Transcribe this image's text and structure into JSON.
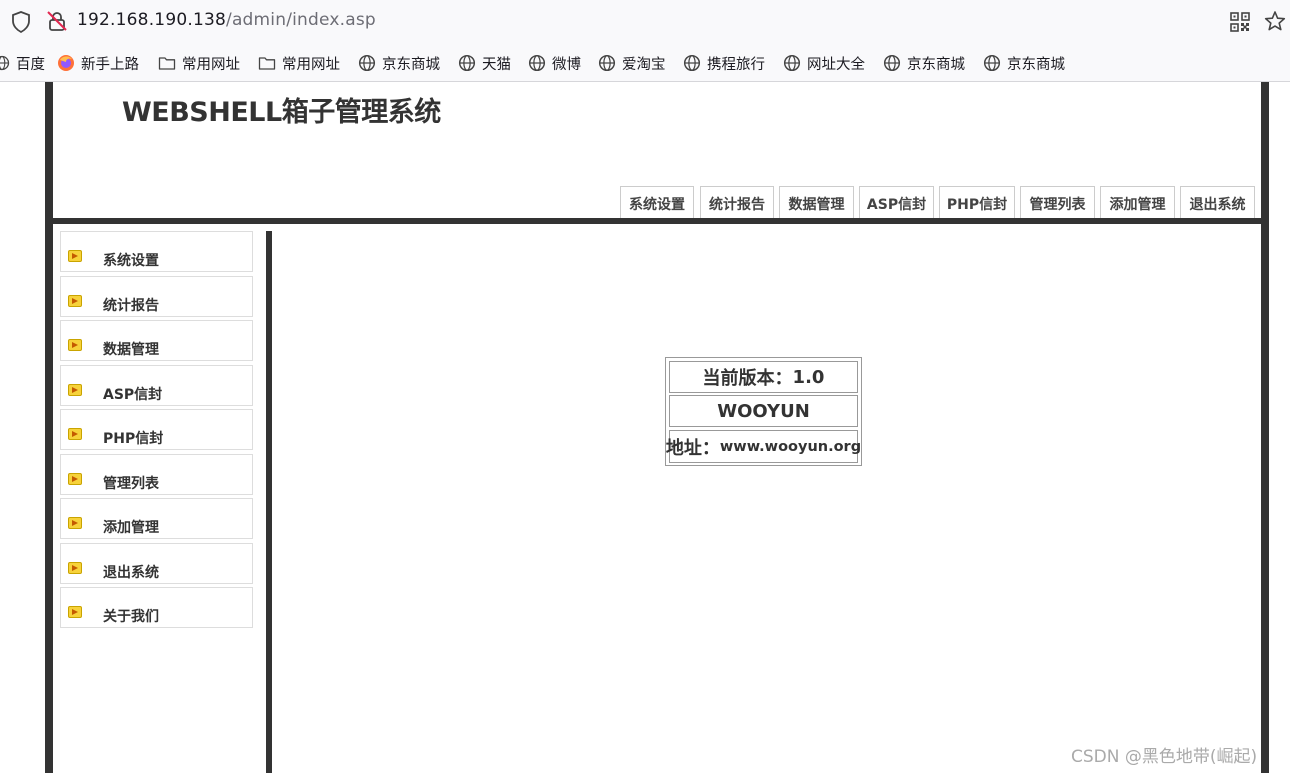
{
  "browser": {
    "url_host": "192.168.190.138",
    "url_path": "/admin/index.asp",
    "bookmarks": [
      {
        "label": "百度",
        "icon": "globe-icon"
      },
      {
        "label": "新手上路",
        "icon": "firefox-icon"
      },
      {
        "label": "常用网址",
        "icon": "folder-icon"
      },
      {
        "label": "常用网址",
        "icon": "folder-icon"
      },
      {
        "label": "京东商城",
        "icon": "globe-icon"
      },
      {
        "label": "天猫",
        "icon": "globe-icon"
      },
      {
        "label": "微博",
        "icon": "globe-icon"
      },
      {
        "label": "爱淘宝",
        "icon": "globe-icon"
      },
      {
        "label": "携程旅行",
        "icon": "globe-icon"
      },
      {
        "label": "网址大全",
        "icon": "globe-icon"
      },
      {
        "label": "京东商城",
        "icon": "globe-icon"
      },
      {
        "label": "京东商城",
        "icon": "globe-icon"
      }
    ]
  },
  "header": {
    "title": "WEBSHELL箱子管理系统",
    "nav": [
      "系统设置",
      "统计报告",
      "数据管理",
      "ASP信封",
      "PHP信封",
      "管理列表",
      "添加管理",
      "退出系统"
    ]
  },
  "sidebar": {
    "items": [
      "系统设置",
      "统计报告",
      "数据管理",
      "ASP信封",
      "PHP信封",
      "管理列表",
      "添加管理",
      "退出系统",
      "关于我们"
    ]
  },
  "info": {
    "version_label": "当前版本：",
    "version_value": "1.0",
    "name": "WOOYUN",
    "address_label": "地址：",
    "address_value": "www.wooyun.org"
  },
  "watermark": "CSDN @黑色地带(崛起)",
  "colors": {
    "frame": "#333333",
    "icon_fill": "#f7d23a"
  }
}
